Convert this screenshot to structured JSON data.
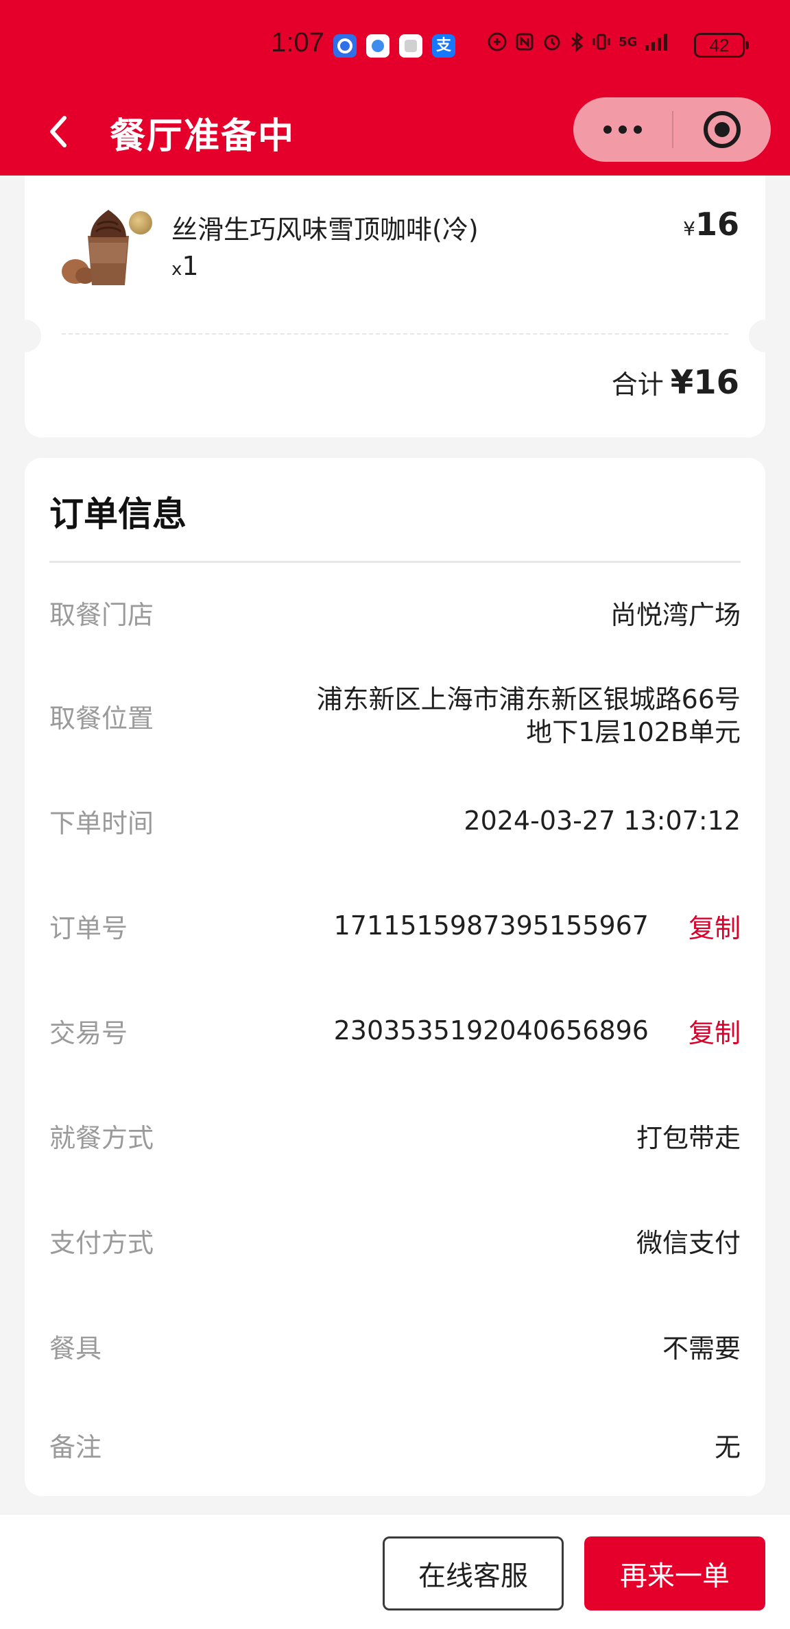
{
  "status_bar": {
    "time": "1:07",
    "app_icons": [
      "app-icon-blue",
      "app-icon-doc",
      "app-icon-db",
      "alipay-icon"
    ],
    "alipay_char": "支",
    "network": "5G",
    "battery": "42"
  },
  "nav": {
    "title": "餐厅准备中"
  },
  "order_item": {
    "name": "丝滑生巧风味雪顶咖啡(冷)",
    "qty_prefix": "x",
    "qty": "1",
    "currency": "¥",
    "price": "16"
  },
  "total": {
    "label": "合计",
    "amount": "¥16"
  },
  "order_info": {
    "title": "订单信息",
    "rows": [
      {
        "label": "取餐门店",
        "value": "尚悦湾广场"
      },
      {
        "label": "取餐位置",
        "value_line1": "浦东新区上海市浦东新区银城路66号",
        "value_line2": "地下1层102B单元"
      },
      {
        "label": "下单时间",
        "value": "2024-03-27 13:07:12"
      },
      {
        "label": "订单号",
        "value": "1711515987395155967",
        "action": "复制"
      },
      {
        "label": "交易号",
        "value": "2303535192040656896",
        "action": "复制"
      },
      {
        "label": "就餐方式",
        "value": "打包带走"
      },
      {
        "label": "支付方式",
        "value": "微信支付"
      },
      {
        "label": "餐具",
        "value": "不需要"
      },
      {
        "label": "备注",
        "value": "无"
      }
    ]
  },
  "bottom": {
    "service_label": "在线客服",
    "reorder_label": "再来一单"
  },
  "colors": {
    "brand_red": "#e4002b",
    "copy_red": "#d9002b"
  }
}
